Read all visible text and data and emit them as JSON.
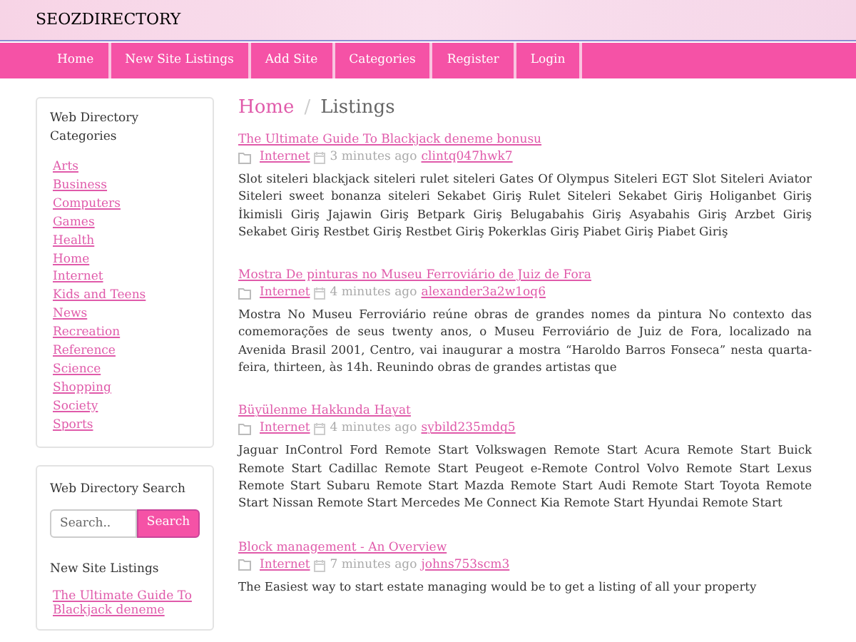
{
  "site_title": "SEOZDIRECTORY",
  "nav": [
    {
      "label": "Home"
    },
    {
      "label": "New Site Listings"
    },
    {
      "label": "Add Site"
    },
    {
      "label": "Categories"
    },
    {
      "label": "Register"
    },
    {
      "label": "Login"
    }
  ],
  "sidebar": {
    "categories_title": "Web Directory Categories",
    "categories": [
      "Arts",
      "Business",
      "Computers",
      "Games",
      "Health",
      "Home",
      "Internet",
      "Kids and Teens",
      "News",
      "Recreation",
      "Reference",
      "Science",
      "Shopping",
      "Society",
      "Sports"
    ],
    "search_title": "Web Directory Search",
    "search": {
      "placeholder": "Search..",
      "button": "Search"
    },
    "new_listings_title": "New Site Listings",
    "new_listings": [
      "The Ultimate Guide To Blackjack deneme"
    ]
  },
  "breadcrumb_separator": "/",
  "breadcrumb": [
    {
      "label": "Home"
    },
    {
      "label": "Listings"
    }
  ],
  "listings": [
    {
      "title": "The Ultimate Guide To Blackjack deneme bonusu",
      "category": "Internet",
      "time": "3 minutes ago",
      "author": "clintq047hwk7",
      "body": "Slot siteleri blackjack siteleri rulet siteleri Gates Of Olympus Siteleri EGT Slot Siteleri Aviator Siteleri sweet bonanza siteleri Sekabet Giriş Rulet Siteleri Sekabet Giriş Holiganbet Giriş İkimisli Giriş Jajawin Giriş Betpark Giriş Belugabahis Giriş Asyabahis Giriş Arzbet Giriş Sekabet Giriş Restbet Giriş Restbet Giriş Pokerklas Giriş Piabet Giriş Piabet Giriş"
    },
    {
      "title": "Mostra De pinturas no Museu Ferroviário de Juiz de Fora",
      "category": "Internet",
      "time": "4 minutes ago",
      "author": "alexander3a2w1oq6",
      "body": "Mostra No Museu Ferroviário reúne obras de grandes nomes da pintura No contexto das comemorações de seus twenty anos, o Museu Ferroviário de Juiz de Fora, localizado na Avenida Brasil 2001, Centro, vai inaugurar a mostra “Haroldo Barros Fonseca” nesta quarta-feira, thirteen, às 14h. Reunindo obras de grandes artistas que"
    },
    {
      "title": "Büyülenme Hakkında Hayat",
      "category": "Internet",
      "time": "4 minutes ago",
      "author": "sybild235mdg5",
      "body": "Jaguar InControl Ford Remote Start Volkswagen Remote Start Acura Remote Start Buick Remote Start Cadillac Remote Start Peugeot e-Remote Control Volvo Remote Start Lexus Remote Start Subaru Remote Start Mazda Remote Start Audi Remote Start Toyota Remote Start Nissan Remote Start Mercedes Me Connect Kia Remote Start Hyundai Remote Start"
    },
    {
      "title": "Block management - An Overview",
      "category": "Internet",
      "time": "7 minutes ago",
      "author": "johns753scm3",
      "body": "The Easiest way to start estate managing would be to get a listing of all your property"
    }
  ]
}
